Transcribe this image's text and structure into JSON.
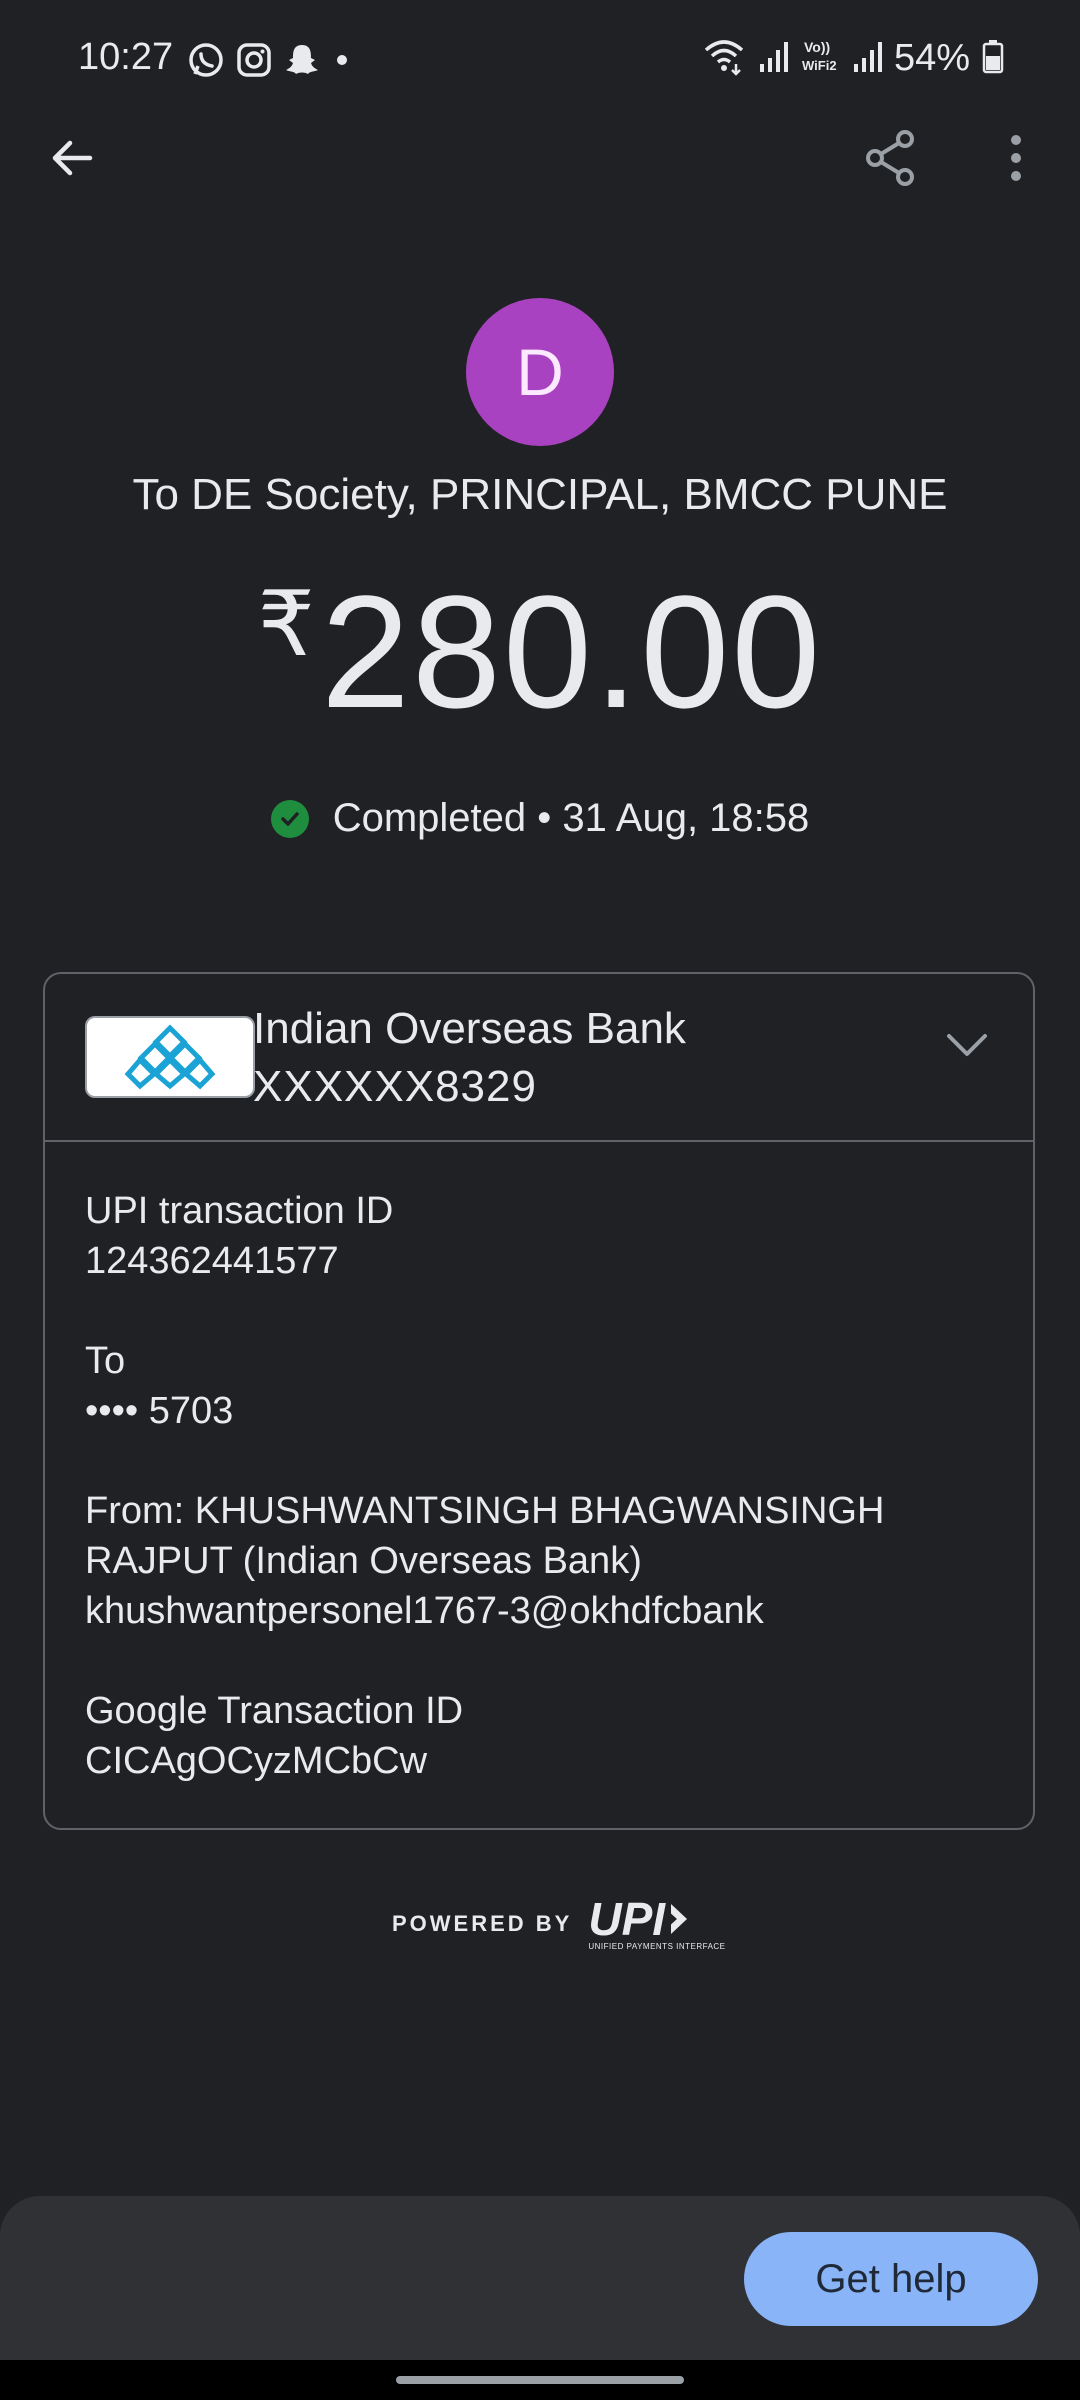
{
  "status_bar": {
    "time": "10:27",
    "battery": "54%",
    "left_icons": [
      "whatsapp-icon",
      "instagram-icon",
      "snapchat-icon",
      "dot-icon"
    ],
    "right_icons": [
      "wifi-icon",
      "signal-icon",
      "volte-wifi-icon",
      "signal-icon",
      "battery-icon"
    ]
  },
  "toolbar": {
    "back_icon": "arrow-left-icon",
    "share_icon": "share-icon",
    "more_icon": "more-vert-icon"
  },
  "payee": {
    "avatar_letter": "D",
    "avatar_color": "#a842c0",
    "title": "To DE Society, PRINCIPAL, BMCC PUNE"
  },
  "amount": {
    "currency": "₹",
    "value": "280.00"
  },
  "status": {
    "text": "Completed • 31 Aug, 18:58",
    "color": "#1e8e3e"
  },
  "bank": {
    "name": "Indian Overseas Bank",
    "account": "XXXXXX8329"
  },
  "details": {
    "upi_label": "UPI transaction ID",
    "upi_value": "124362441577",
    "to_label": "To",
    "to_value": "•••• 5703",
    "from_line1": "From: KHUSHWANTSINGH BHAGWANSINGH",
    "from_line2": "RAJPUT (Indian Overseas Bank)",
    "from_vpa": "khushwantpersonel1767-3@okhdfcbank",
    "google_label": "Google Transaction ID",
    "google_value": "CICAgOCyzMCbCw"
  },
  "footer": {
    "powered_by": "POWERED BY",
    "upi_logo_text": "UPI",
    "upi_logo_sub": "UNIFIED PAYMENTS INTERFACE"
  },
  "help_button": {
    "label": "Get help",
    "color": "#8ab4f8"
  }
}
